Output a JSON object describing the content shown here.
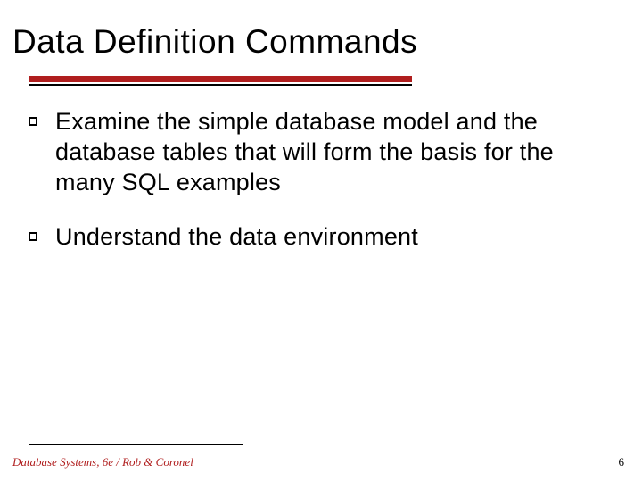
{
  "title": "Data Definition Commands",
  "bullets": [
    "Examine the simple database model and the database tables that will form the basis for the many SQL examples",
    "Understand the data environment"
  ],
  "footer": {
    "left": "Database Systems, 6e / Rob & Coronel",
    "page": "6"
  },
  "colors": {
    "accentRed": "#b01e1e"
  }
}
